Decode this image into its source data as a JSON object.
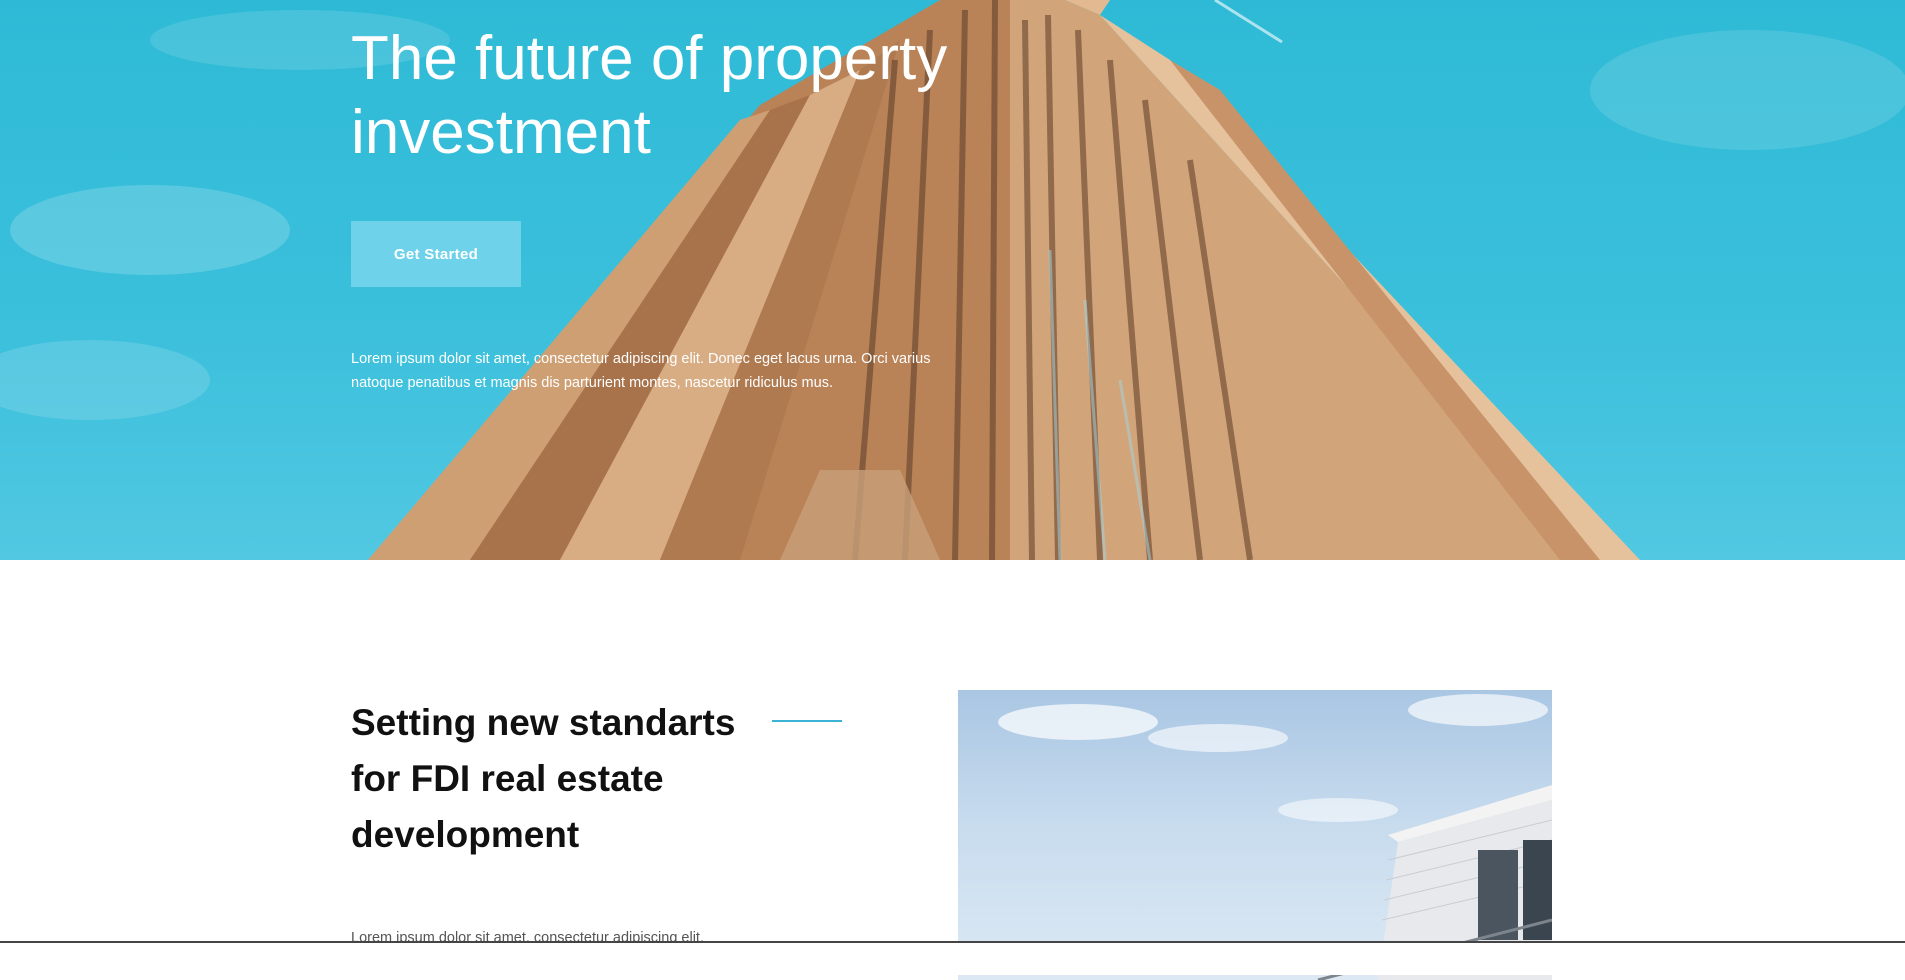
{
  "hero": {
    "title": "The future of property investment",
    "cta_label": "Get Started",
    "text": "Lorem ipsum dolor sit amet, consectetur adipiscing elit. Donec eget lacus urna. Orci varius natoque penatibus et magnis dis parturient montes, nascetur ridiculus mus."
  },
  "section": {
    "title": "Setting new standarts for FDI real estate development",
    "text": "Lorem ipsum dolor sit amet, consectetur adipiscing elit."
  },
  "colors": {
    "sky": "#3cc0dc",
    "building": "#c9956a",
    "accent": "#3bb3d4",
    "cta": "#78d6ec"
  }
}
